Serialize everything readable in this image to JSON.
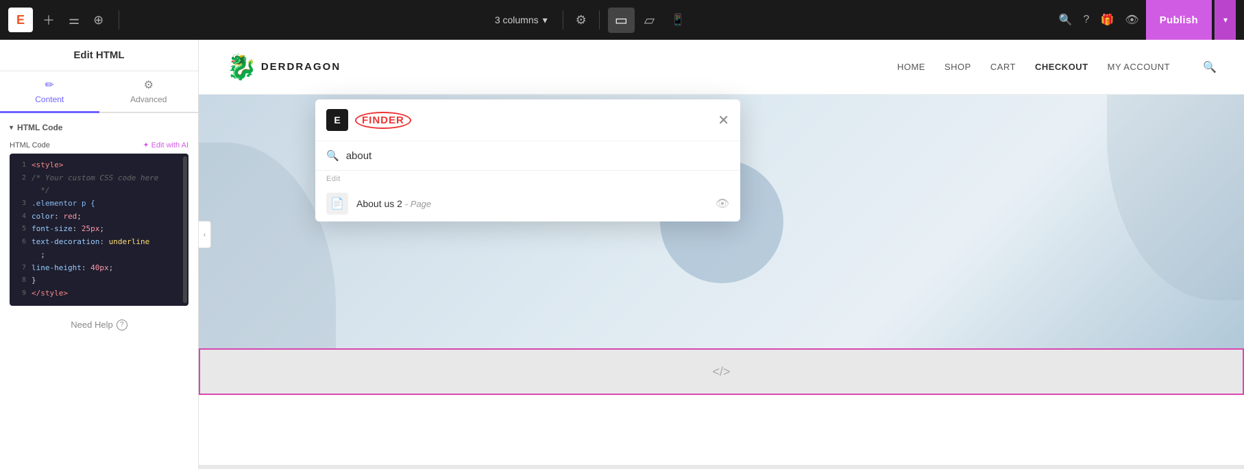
{
  "toolbar": {
    "logo": "E",
    "columns_label": "3 columns",
    "columns_chevron": "▾",
    "gear_icon": "⚙",
    "desktop_icon": "▭",
    "tablet_icon": "▱",
    "mobile_icon": "📱",
    "search_icon": "🔍",
    "question_icon": "?",
    "gift_icon": "🎁",
    "eye_icon": "👁",
    "publish_label": "Publish",
    "publish_arrow": "▾"
  },
  "left_panel": {
    "title": "Edit HTML",
    "tabs": [
      {
        "id": "content",
        "label": "Content",
        "icon": "✏",
        "active": true
      },
      {
        "id": "advanced",
        "label": "Advanced",
        "icon": "⚙",
        "active": false
      }
    ],
    "section_title": "HTML Code",
    "code_label": "HTML Code",
    "edit_ai_label": "✦ Edit with AI",
    "code_lines": [
      {
        "num": "1",
        "content": "<style>",
        "type": "tag"
      },
      {
        "num": "2",
        "content": "/* Your custom CSS code here",
        "type": "comment"
      },
      {
        "num": "",
        "content": "*/",
        "type": "comment"
      },
      {
        "num": "3",
        "content": ".elementor p {",
        "type": "selector"
      },
      {
        "num": "4",
        "content": "    color: red;",
        "type": "prop"
      },
      {
        "num": "5",
        "content": "    font-size: 25px;",
        "type": "prop"
      },
      {
        "num": "6",
        "content": "    text-decoration: underline",
        "type": "prop"
      },
      {
        "num": "",
        "content": "    ;",
        "type": "plain"
      },
      {
        "num": "7",
        "content": "    line-height: 40px;",
        "type": "prop"
      },
      {
        "num": "8",
        "content": "}",
        "type": "plain"
      },
      {
        "num": "9",
        "content": "</style>",
        "type": "tag"
      }
    ],
    "need_help_label": "Need Help",
    "help_icon": "?"
  },
  "site_nav": {
    "logo_text": "DERDRAGON",
    "links": [
      "HOME",
      "SHOP",
      "CART",
      "CHECKOUT",
      "MY ACCOUNT"
    ],
    "active_link": "CHECKOUT"
  },
  "finder": {
    "logo": "E",
    "brand": "FINDER",
    "close_icon": "✕",
    "search_placeholder": "about",
    "search_icon": "🔍",
    "section_label": "Edit",
    "result": {
      "icon": "📄",
      "name": "About us 2",
      "type": "Page",
      "eye_icon": "👁"
    }
  },
  "html_block": {
    "icon": "</>",
    "border_color": "#d946b0"
  },
  "collapse_btn": "‹"
}
